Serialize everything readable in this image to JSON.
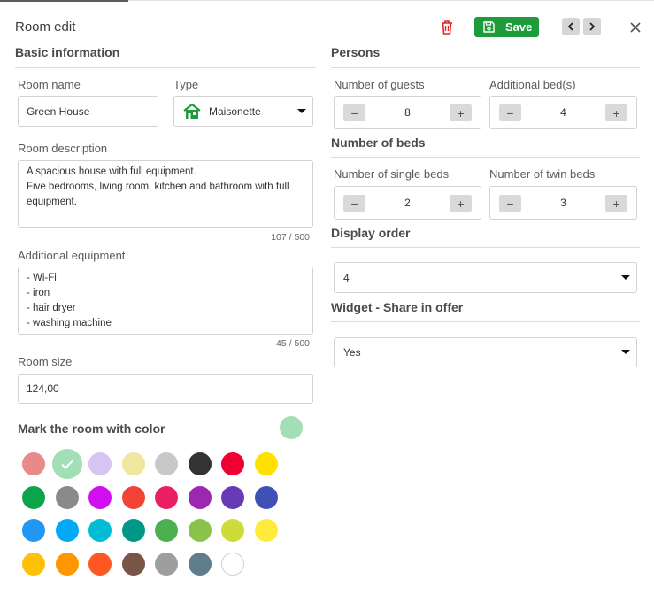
{
  "header": {
    "title": "Room edit",
    "save_label": "Save"
  },
  "basic": {
    "section_title": "Basic information",
    "room_name_label": "Room name",
    "room_name_value": "Green House",
    "type_label": "Type",
    "type_value": "Maisonette",
    "type_icon": "house-icon",
    "description_label": "Room description",
    "description_value": "A spacious house with full equipment.\nFive bedrooms, living room, kitchen and bathroom with full equipment.",
    "description_counter": "107 / 500",
    "equipment_label": "Additional equipment",
    "equipment_value": "- Wi-Fi\n- iron\n- hair dryer\n- washing machine",
    "equipment_counter": "45 / 500",
    "size_label": "Room size",
    "size_value": "124,00",
    "color_label": "Mark the room with color",
    "selected_color": "#a2dfb6"
  },
  "persons": {
    "section_title": "Persons",
    "guests_label": "Number of guests",
    "guests_value": "8",
    "beds_label": "Additional bed(s)",
    "beds_value": "4"
  },
  "beds": {
    "section_title": "Number of beds",
    "single_label": "Number of single beds",
    "single_value": "2",
    "twin_label": "Number of twin beds",
    "twin_value": "3"
  },
  "display_order": {
    "section_title": "Display order",
    "value": "4"
  },
  "widget": {
    "section_title": "Widget - Share in offer",
    "value": "Yes"
  },
  "colors": [
    [
      "#e88a8a",
      "#a2dfb6",
      "#d8c4f0",
      "#efe6a0",
      "#c8c8c8",
      "#333333",
      "#f00032",
      "#ffe100"
    ],
    [
      "#0aa54a",
      "#8a8a8a",
      "#d10ef0",
      "#f44336",
      "#e91e63",
      "#9c27b0",
      "#673ab7",
      "#3f51b5"
    ],
    [
      "#2196f3",
      "#03a9f4",
      "#00bcd4",
      "#009688",
      "#4caf50",
      "#8bc34a",
      "#cddc39",
      "#ffeb3b"
    ],
    [
      "#ffc107",
      "#ff9800",
      "#ff5722",
      "#795548",
      "#9e9e9e",
      "#607d8b",
      "#ffffff"
    ]
  ],
  "colors_selected_index": [
    0,
    1
  ]
}
